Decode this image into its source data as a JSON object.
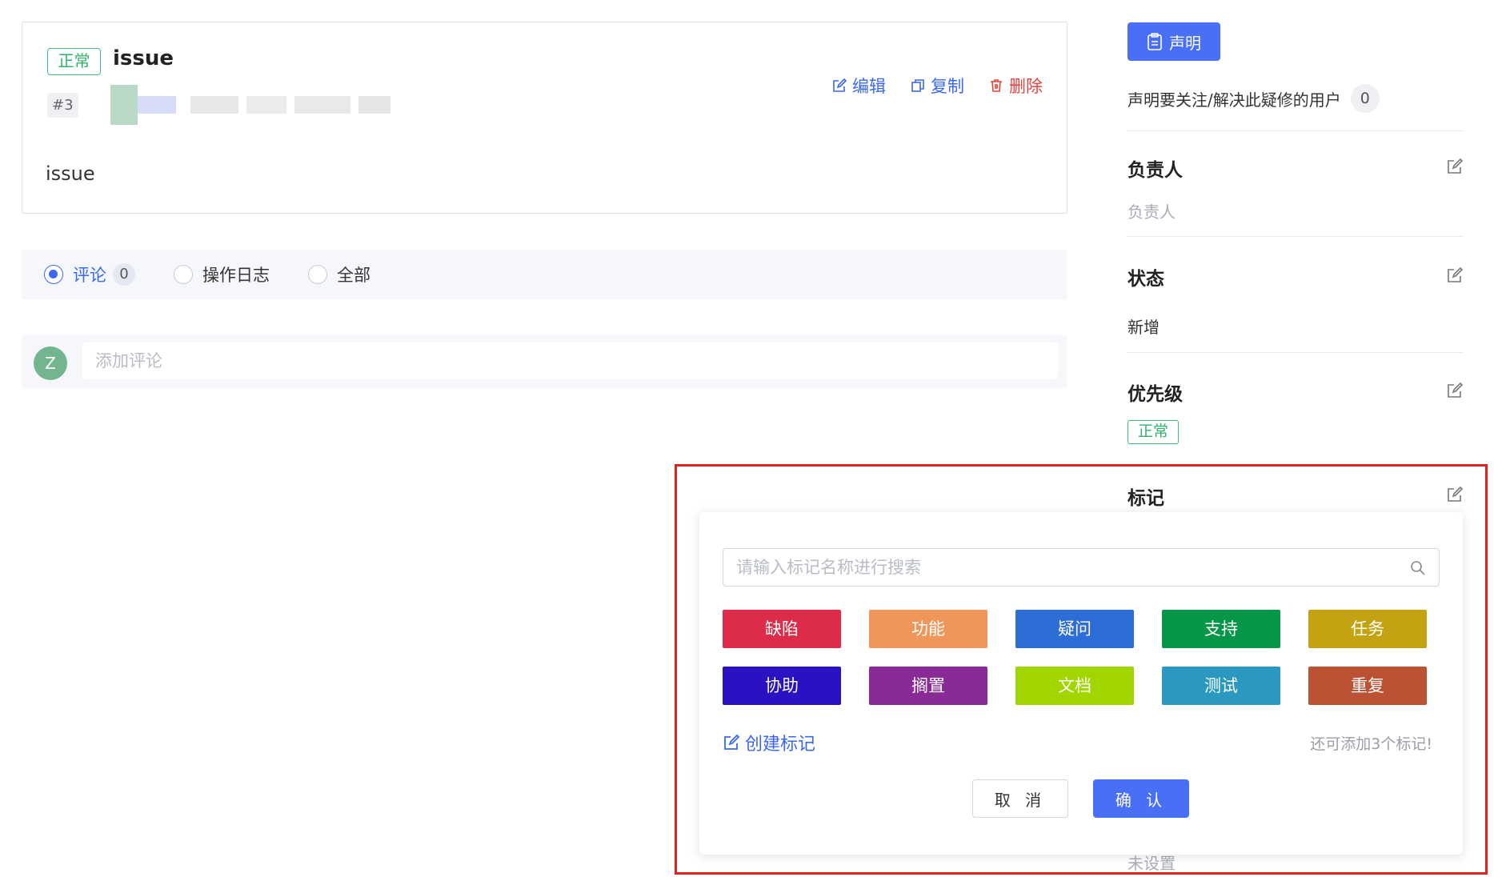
{
  "issue": {
    "priority_tag": "正常",
    "title": "issue",
    "number": "#3",
    "body": "issue",
    "actions": {
      "edit": "编辑",
      "copy": "复制",
      "delete": "删除"
    }
  },
  "activity": {
    "tabs": [
      {
        "label": "评论",
        "count": "0"
      },
      {
        "label": "操作日志"
      },
      {
        "label": "全部"
      }
    ],
    "selected": "评论"
  },
  "comment": {
    "avatar_letter": "Z",
    "placeholder": "添加评论"
  },
  "sidebar": {
    "declare_button": "声明",
    "follow_text": "声明要关注/解决此疑修的用户",
    "follow_count": "0",
    "assignee": {
      "title": "负责人",
      "value": "负责人"
    },
    "status": {
      "title": "状态",
      "value": "新增"
    },
    "priority": {
      "title": "优先级",
      "value": "正常"
    },
    "tags": {
      "title": "标记"
    },
    "unset_text": "未设置"
  },
  "tag_picker": {
    "search_placeholder": "请输入标记名称进行搜索",
    "tags": [
      {
        "label": "缺陷",
        "color": "#dc2c49"
      },
      {
        "label": "功能",
        "color": "#ef965a"
      },
      {
        "label": "疑问",
        "color": "#2d6dd6"
      },
      {
        "label": "支持",
        "color": "#059649"
      },
      {
        "label": "任务",
        "color": "#c4a312"
      },
      {
        "label": "协助",
        "color": "#2a12c2"
      },
      {
        "label": "搁置",
        "color": "#892a96"
      },
      {
        "label": "文档",
        "color": "#a2d600"
      },
      {
        "label": "测试",
        "color": "#2b99bf"
      },
      {
        "label": "重复",
        "color": "#bb5233"
      }
    ],
    "create_label": "创建标记",
    "remaining_text": "还可添加3个标记!",
    "cancel_label": "取 消",
    "confirm_label": "确 认"
  },
  "colors": {
    "primary": "#4a6ff7",
    "link": "#3a68f2",
    "danger": "#e8423c",
    "success": "#2fb16a",
    "highlight_border": "#e3201b"
  }
}
